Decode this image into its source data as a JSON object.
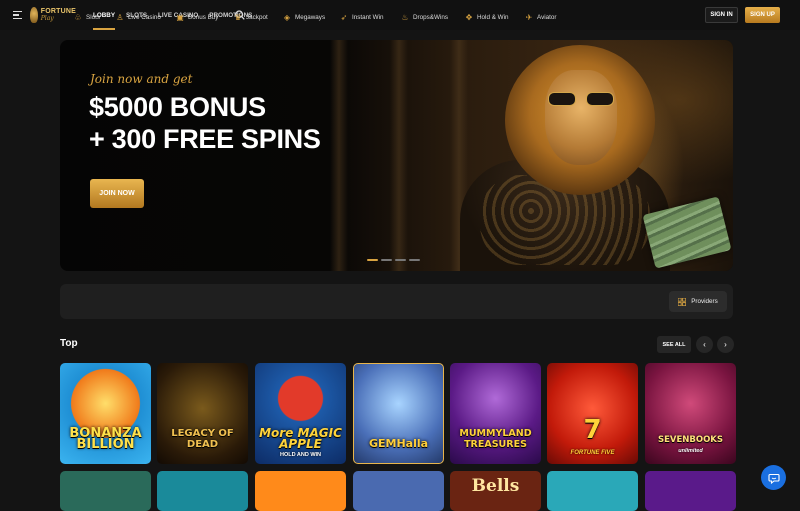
{
  "header": {
    "logo_line1": "FORTUNE",
    "logo_line2": "Play",
    "nav": [
      {
        "label": "LOBBY",
        "active": true
      },
      {
        "label": "SLOTS"
      },
      {
        "label": "LIVE CASINO"
      },
      {
        "label": "PROMOTIONS"
      }
    ],
    "sign_in": "SIGN IN",
    "sign_up": "SIGN UP"
  },
  "hero": {
    "tagline": "Join now and get",
    "title_line1": "$5000 BONUS",
    "title_line2": "+ 300 FREE SPINS",
    "cta": "JOIN NOW",
    "slides": 4,
    "active_slide": 1
  },
  "categories": [
    {
      "label": "Slots",
      "icon": "slots-icon"
    },
    {
      "label": "Live Casino",
      "icon": "live-casino-icon"
    },
    {
      "label": "Bonus Buy",
      "icon": "bonus-buy-icon"
    },
    {
      "label": "Jackpot",
      "icon": "jackpot-icon"
    },
    {
      "label": "Megaways",
      "icon": "megaways-icon"
    },
    {
      "label": "Instant Win",
      "icon": "instant-win-icon"
    },
    {
      "label": "Drops&Wins",
      "icon": "drops-wins-icon"
    },
    {
      "label": "Hold & Win",
      "icon": "hold-win-icon"
    },
    {
      "label": "Aviator",
      "icon": "aviator-icon"
    }
  ],
  "providers_label": "Providers",
  "top_section": {
    "title": "Top",
    "see_all": "SEE ALL",
    "games": [
      {
        "title": "BONANZA BILLION",
        "sub": ""
      },
      {
        "title": "LEGACY OF DEAD",
        "sub": ""
      },
      {
        "title": "More MAGIC APPLE",
        "sub": "HOLD AND WIN"
      },
      {
        "title": "GEMHalla",
        "sub": ""
      },
      {
        "title": "MUMMYLAND TREASURES",
        "sub": ""
      },
      {
        "title": "7",
        "sub": "FORTUNE FIVE"
      },
      {
        "title": "SEVENBOOKS",
        "sub": "unlimited"
      }
    ],
    "second_row": [
      {
        "title": ""
      },
      {
        "title": ""
      },
      {
        "title": ""
      },
      {
        "title": ""
      },
      {
        "title": "Bells"
      },
      {
        "title": ""
      },
      {
        "title": ""
      }
    ]
  },
  "colors": {
    "accent": "#d9a441",
    "background": "#141414",
    "chat": "#1a6fe0"
  }
}
